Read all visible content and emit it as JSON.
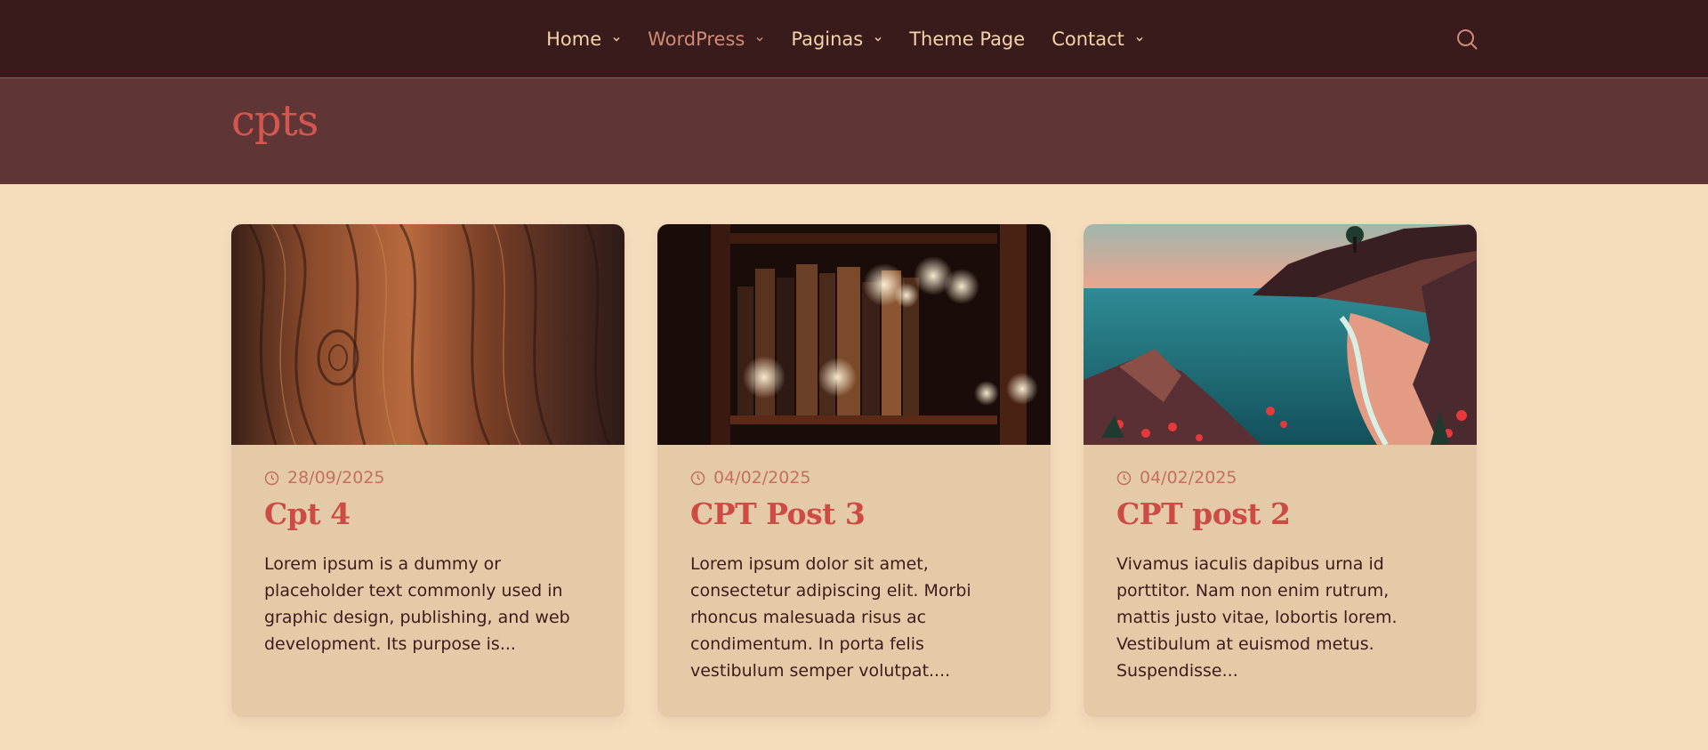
{
  "nav": {
    "items": [
      {
        "label": "Home",
        "has_dropdown": true,
        "active": false
      },
      {
        "label": "WordPress",
        "has_dropdown": true,
        "active": true
      },
      {
        "label": "Paginas",
        "has_dropdown": true,
        "active": false
      },
      {
        "label": "Theme Page",
        "has_dropdown": false,
        "active": false
      },
      {
        "label": "Contact",
        "has_dropdown": true,
        "active": false
      }
    ],
    "search_icon": "search-icon"
  },
  "page": {
    "title": "cpts"
  },
  "posts": [
    {
      "date": "28/09/2025",
      "title": "Cpt 4",
      "excerpt": "Lorem ipsum is a dummy or placeholder text commonly used in graphic design, publishing, and web development. Its purpose is...",
      "image": "wood-grain"
    },
    {
      "date": "04/02/2025",
      "title": "CPT Post 3",
      "excerpt": "Lorem ipsum dolor sit amet, consectetur adipiscing elit. Morbi rhoncus malesuada risus ac condimentum. In porta felis vestibulum semper volutpat....",
      "image": "bookshelf"
    },
    {
      "date": "04/02/2025",
      "title": "CPT post 2",
      "excerpt": "Vivamus iaculis dapibus urna id porttitor. Nam non enim rutrum, mattis justo vitae, lobortis lorem. Vestibulum at euismod metus. Suspendisse...",
      "image": "coastline"
    }
  ],
  "colors": {
    "header_bg": "#381b1a",
    "hero_bg": "#5f3535",
    "page_bg": "#f4dcbd",
    "card_bg": "#e5caa8",
    "accent": "#cc4b45",
    "nav_text": "#f4d3a9",
    "nav_active": "#d08a78"
  }
}
